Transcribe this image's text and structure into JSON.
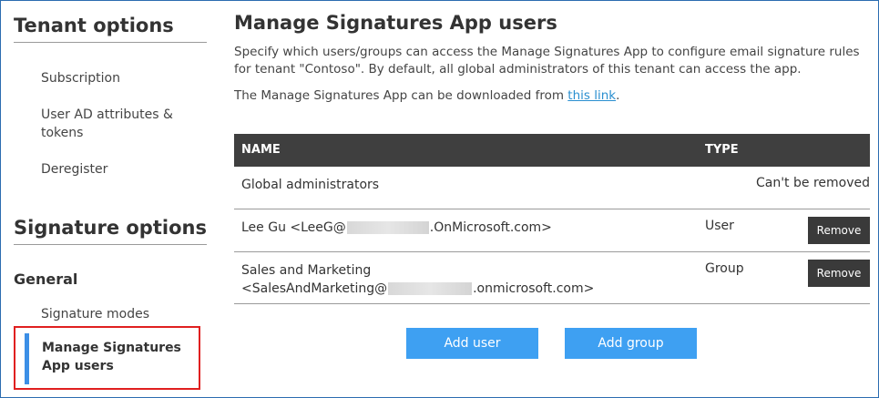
{
  "sidebar": {
    "tenant_heading": "Tenant options",
    "tenant_items": [
      {
        "label": "Subscription"
      },
      {
        "label": "User AD attributes & tokens"
      },
      {
        "label": "Deregister"
      }
    ],
    "signature_heading": "Signature options",
    "group_label": "General",
    "signature_items": [
      {
        "label": "Signature modes"
      },
      {
        "label": "Manage Signatures App users",
        "active": true
      }
    ]
  },
  "main": {
    "title": "Manage Signatures App users",
    "description": "Specify which users/groups can access the Manage Signatures App to configure email signature rules for tenant \"Contoso\". By default, all global administrators of this tenant can access the app.",
    "download_prefix": "The Manage Signatures App can be downloaded from ",
    "download_link": "this link",
    "download_suffix": ".",
    "table": {
      "headers": {
        "name": "NAME",
        "type": "TYPE"
      },
      "rows": [
        {
          "name": "Global administrators",
          "type": "",
          "note": "Can't be removed"
        },
        {
          "name_prefix": "Lee Gu <LeeG@",
          "name_suffix": ".OnMicrosoft.com>",
          "type": "User",
          "action": "Remove"
        },
        {
          "name_line1": "Sales and Marketing",
          "name_prefix": "<SalesAndMarketing@",
          "name_suffix": ".onmicrosoft.com>",
          "type": "Group",
          "action": "Remove"
        }
      ]
    },
    "add_user": "Add user",
    "add_group": "Add group"
  },
  "colors": {
    "accent": "#3ea0f2",
    "active_bar": "#3c8fe6",
    "highlight_border": "#e02020",
    "table_header": "#3f3f3f",
    "link": "#2a8fd0"
  }
}
